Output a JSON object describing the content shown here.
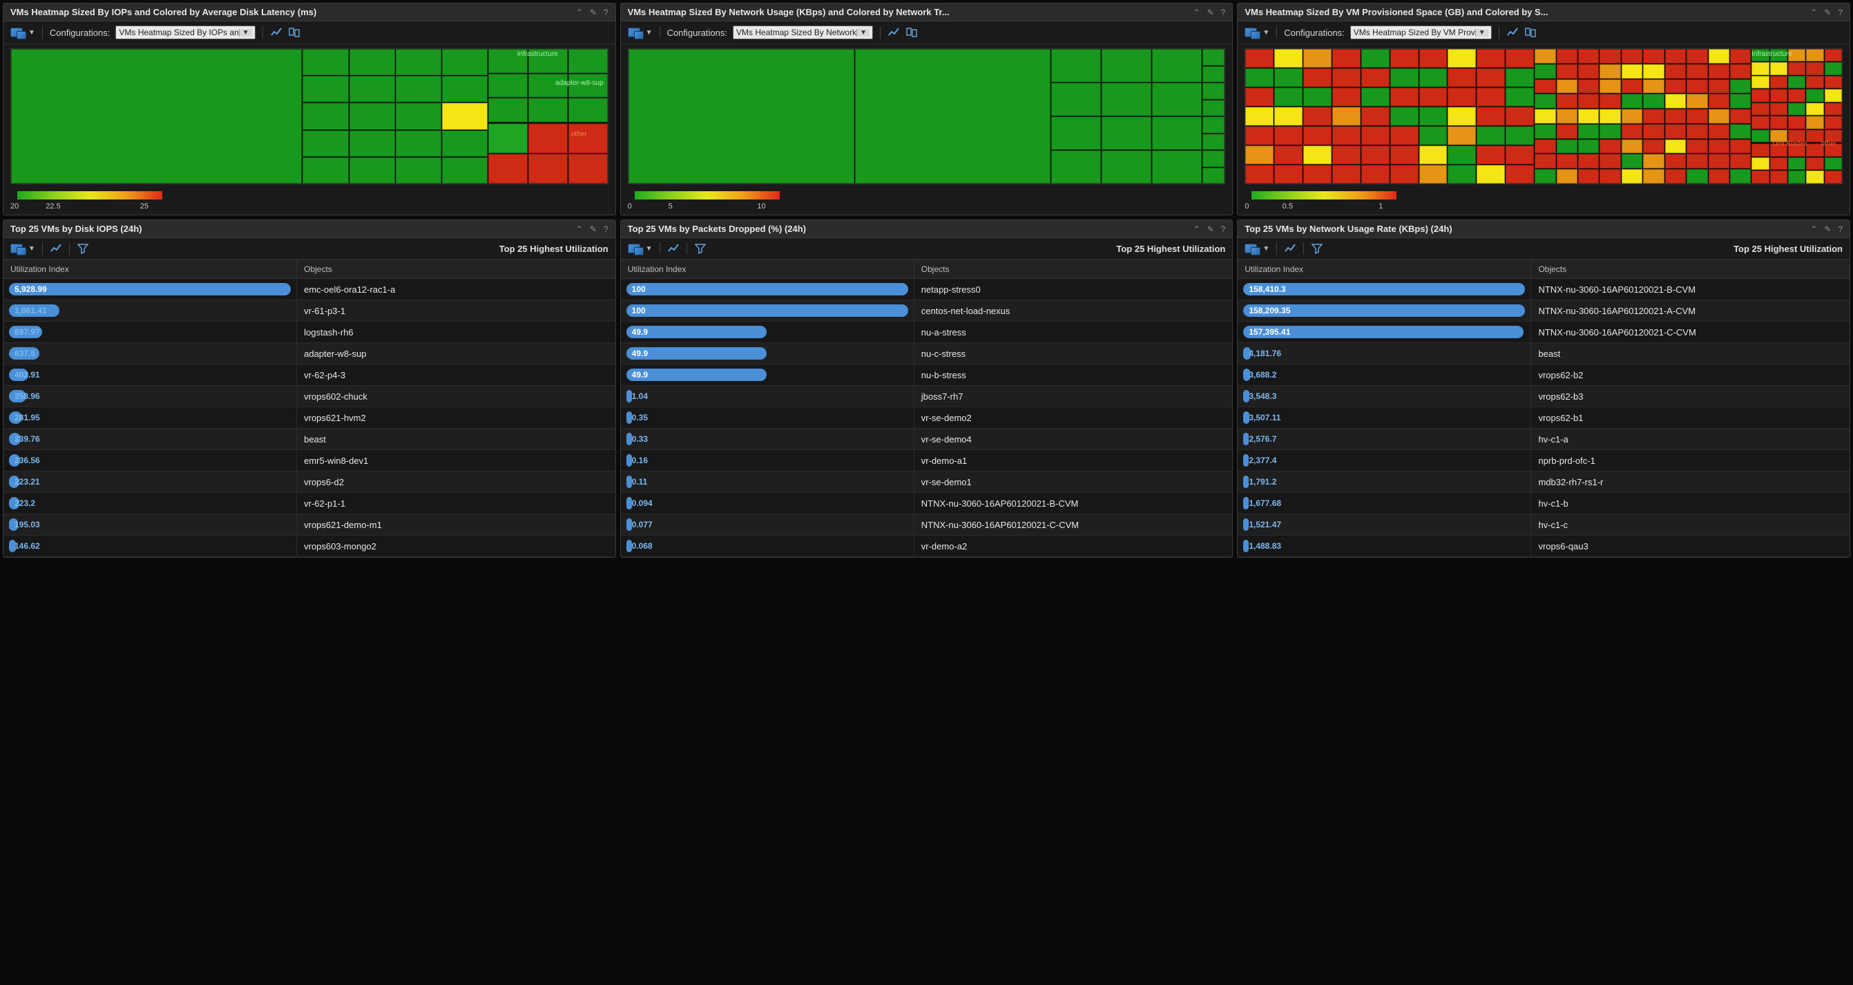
{
  "panels": {
    "heatmap_iops": {
      "title": "VMs Heatmap Sized By IOPs and Colored by Average Disk Latency (ms)",
      "config_label": "Configurations:",
      "config_value": "VMs Heatmap Sized By IOPs an",
      "labels": {
        "infra": "Infrastructure",
        "adapter": "adapter-w8-sup",
        "other": "other"
      },
      "legend": {
        "min": "20",
        "mid": "22.5",
        "max": "25"
      }
    },
    "heatmap_net": {
      "title": "VMs Heatmap Sized By Network Usage (KBps) and Colored by Network Tr...",
      "config_label": "Configurations:",
      "config_value": "VMs Heatmap Sized By Network",
      "legend": {
        "min": "0",
        "mid": "5",
        "max": "10"
      }
    },
    "heatmap_space": {
      "title": "VMs Heatmap Sized By VM Provisioned Space (GB) and Colored by S...",
      "config_label": "Configurations:",
      "config_value": "VMs Heatmap Sized By VM Prov",
      "labels": {
        "infra": "Infrastructure",
        "dell": "Dell Blades",
        "other": "other"
      },
      "legend": {
        "min": "0",
        "mid": "0.5",
        "max": "1"
      }
    },
    "top_iops": {
      "title": "Top 25 VMs by Disk IOPS (24h)",
      "subtitle": "Top 25 Highest Utilization",
      "col1": "Utilization Index",
      "col2": "Objects",
      "max": 5928.99,
      "rows": [
        {
          "v": "5,928.99",
          "n": 5928.99,
          "o": "emc-oel6-ora12-rac1-a"
        },
        {
          "v": "1,061.41",
          "n": 1061.41,
          "o": "vr-61-p3-1"
        },
        {
          "v": "697.97",
          "n": 697.97,
          "o": "logstash-rh6"
        },
        {
          "v": "637.5",
          "n": 637.5,
          "o": "adapter-w8-sup"
        },
        {
          "v": "402.91",
          "n": 402.91,
          "o": "vr-62-p4-3"
        },
        {
          "v": "358.96",
          "n": 358.96,
          "o": "vrops602-chuck"
        },
        {
          "v": "281.95",
          "n": 281.95,
          "o": "vrops621-hvm2"
        },
        {
          "v": "239.76",
          "n": 239.76,
          "o": "beast"
        },
        {
          "v": "236.56",
          "n": 236.56,
          "o": "emr5-win8-dev1"
        },
        {
          "v": "223.21",
          "n": 223.21,
          "o": "vrops6-d2"
        },
        {
          "v": "223.2",
          "n": 223.2,
          "o": "vr-62-p1-1"
        },
        {
          "v": "195.03",
          "n": 195.03,
          "o": "vrops621-demo-m1"
        },
        {
          "v": "146.62",
          "n": 146.62,
          "o": "vrops603-mongo2"
        }
      ]
    },
    "top_packets": {
      "title": "Top 25 VMs by Packets Dropped (%) (24h)",
      "subtitle": "Top 25 Highest Utilization",
      "col1": "Utilization Index",
      "col2": "Objects",
      "max": 100,
      "rows": [
        {
          "v": "100",
          "n": 100,
          "o": "netapp-stress0"
        },
        {
          "v": "100",
          "n": 100,
          "o": "centos-net-load-nexus"
        },
        {
          "v": "49.9",
          "n": 49.9,
          "o": "nu-a-stress"
        },
        {
          "v": "49.9",
          "n": 49.9,
          "o": "nu-c-stress"
        },
        {
          "v": "49.9",
          "n": 49.9,
          "o": "nu-b-stress"
        },
        {
          "v": "1.04",
          "n": 1.04,
          "o": "jboss7-rh7"
        },
        {
          "v": "0.35",
          "n": 0.35,
          "o": "vr-se-demo2"
        },
        {
          "v": "0.33",
          "n": 0.33,
          "o": "vr-se-demo4"
        },
        {
          "v": "0.16",
          "n": 0.16,
          "o": "vr-demo-a1"
        },
        {
          "v": "0.11",
          "n": 0.11,
          "o": "vr-se-demo1"
        },
        {
          "v": "0.094",
          "n": 0.094,
          "o": "NTNX-nu-3060-16AP60120021-B-CVM"
        },
        {
          "v": "0.077",
          "n": 0.077,
          "o": "NTNX-nu-3060-16AP60120021-C-CVM"
        },
        {
          "v": "0.068",
          "n": 0.068,
          "o": "vr-demo-a2"
        }
      ]
    },
    "top_netrate": {
      "title": "Top 25 VMs by Network Usage Rate (KBps) (24h)",
      "subtitle": "Top 25 Highest Utilization",
      "col1": "Utilization Index",
      "col2": "Objects",
      "max": 158410.3,
      "rows": [
        {
          "v": "158,410.3",
          "n": 158410.3,
          "o": "NTNX-nu-3060-16AP60120021-B-CVM"
        },
        {
          "v": "158,209.35",
          "n": 158209.35,
          "o": "NTNX-nu-3060-16AP60120021-A-CVM"
        },
        {
          "v": "157,395.41",
          "n": 157395.41,
          "o": "NTNX-nu-3060-16AP60120021-C-CVM"
        },
        {
          "v": "4,181.76",
          "n": 4181.76,
          "o": "beast"
        },
        {
          "v": "3,688.2",
          "n": 3688.2,
          "o": "vrops62-b2"
        },
        {
          "v": "3,548.3",
          "n": 3548.3,
          "o": "vrops62-b3"
        },
        {
          "v": "3,507.11",
          "n": 3507.11,
          "o": "vrops62-b1"
        },
        {
          "v": "2,576.7",
          "n": 2576.7,
          "o": "hv-c1-a"
        },
        {
          "v": "2,377.4",
          "n": 2377.4,
          "o": "nprb-prd-ofc-1"
        },
        {
          "v": "1,791.2",
          "n": 1791.2,
          "o": "mdb32-rh7-rs1-r"
        },
        {
          "v": "1,677.68",
          "n": 1677.68,
          "o": "hv-c1-b"
        },
        {
          "v": "1,521.47",
          "n": 1521.47,
          "o": "hv-c1-c"
        },
        {
          "v": "1,488.83",
          "n": 1488.83,
          "o": "vrops6-qau3"
        }
      ]
    }
  },
  "chart_data": [
    {
      "type": "heatmap",
      "title": "VMs Heatmap Sized By IOPs and Colored by Average Disk Latency (ms)",
      "color_scale": {
        "min": 20,
        "mid": 22.5,
        "max": 25
      },
      "groups": [
        "Infrastructure",
        "adapter-w8-sup",
        "other"
      ],
      "note": "Majority of cells are low-latency (green ~20ms); one small cell is yellow (~22.5ms); the 'other' group shows several red cells (~25ms)."
    },
    {
      "type": "heatmap",
      "title": "VMs Heatmap Sized By Network Usage (KBps) and Colored by Network Tr...",
      "color_scale": {
        "min": 0,
        "mid": 5,
        "max": 10
      },
      "note": "All visible cells are green indicating low network-transmit coloring (~0)."
    },
    {
      "type": "heatmap",
      "title": "VMs Heatmap Sized By VM Provisioned Space (GB) and Colored by S...",
      "color_scale": {
        "min": 0,
        "mid": 0.5,
        "max": 1
      },
      "groups": [
        "Infrastructure",
        "Dell Blades",
        "other"
      ],
      "note": "Most cells are red (~1) with scattered green (~0), a few yellow (~0.5) and orange (~0.7) cells."
    },
    {
      "type": "bar",
      "title": "Top 25 VMs by Disk IOPS (24h)",
      "ylabel": "Utilization Index",
      "categories": [
        "emc-oel6-ora12-rac1-a",
        "vr-61-p3-1",
        "logstash-rh6",
        "adapter-w8-sup",
        "vr-62-p4-3",
        "vrops602-chuck",
        "vrops621-hvm2",
        "beast",
        "emr5-win8-dev1",
        "vrops6-d2",
        "vr-62-p1-1",
        "vrops621-demo-m1",
        "vrops603-mongo2"
      ],
      "values": [
        5928.99,
        1061.41,
        697.97,
        637.5,
        402.91,
        358.96,
        281.95,
        239.76,
        236.56,
        223.21,
        223.2,
        195.03,
        146.62
      ]
    },
    {
      "type": "bar",
      "title": "Top 25 VMs by Packets Dropped (%) (24h)",
      "ylabel": "Utilization Index",
      "categories": [
        "netapp-stress0",
        "centos-net-load-nexus",
        "nu-a-stress",
        "nu-c-stress",
        "nu-b-stress",
        "jboss7-rh7",
        "vr-se-demo2",
        "vr-se-demo4",
        "vr-demo-a1",
        "vr-se-demo1",
        "NTNX-nu-3060-16AP60120021-B-CVM",
        "NTNX-nu-3060-16AP60120021-C-CVM",
        "vr-demo-a2"
      ],
      "values": [
        100,
        100,
        49.9,
        49.9,
        49.9,
        1.04,
        0.35,
        0.33,
        0.16,
        0.11,
        0.094,
        0.077,
        0.068
      ]
    },
    {
      "type": "bar",
      "title": "Top 25 VMs by Network Usage Rate (KBps) (24h)",
      "ylabel": "Utilization Index",
      "categories": [
        "NTNX-nu-3060-16AP60120021-B-CVM",
        "NTNX-nu-3060-16AP60120021-A-CVM",
        "NTNX-nu-3060-16AP60120021-C-CVM",
        "beast",
        "vrops62-b2",
        "vrops62-b3",
        "vrops62-b1",
        "hv-c1-a",
        "nprb-prd-ofc-1",
        "mdb32-rh7-rs1-r",
        "hv-c1-b",
        "hv-c1-c",
        "vrops6-qau3"
      ],
      "values": [
        158410.3,
        158209.35,
        157395.41,
        4181.76,
        3688.2,
        3548.3,
        3507.11,
        2576.7,
        2377.4,
        1791.2,
        1677.68,
        1521.47,
        1488.83
      ]
    }
  ]
}
